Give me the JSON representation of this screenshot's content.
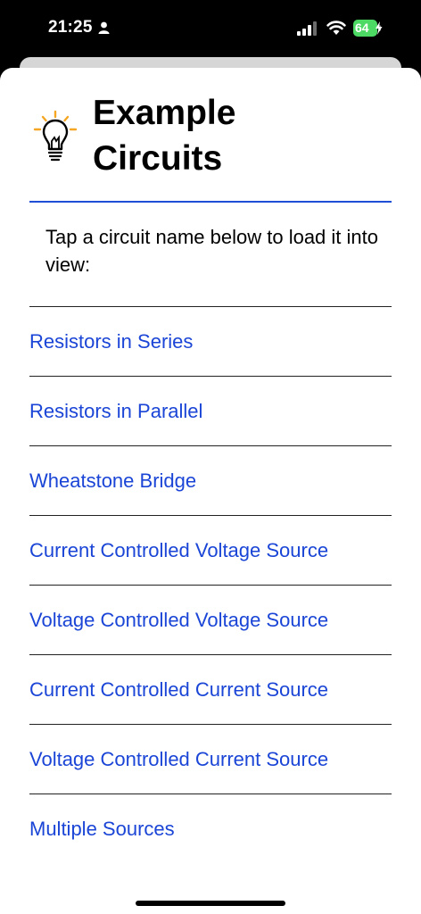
{
  "status_bar": {
    "time": "21:25",
    "battery": "64",
    "icons": [
      "person-icon",
      "signal-icon",
      "wifi-icon",
      "battery-icon",
      "charging-bolt-icon"
    ]
  },
  "header": {
    "icon": "lightbulb-icon",
    "title_line1": "Example",
    "title_line2": "Circuits",
    "accent_color": "#1e4fd6",
    "bulb_ray_color": "#f5a623"
  },
  "intro_text": "Tap a circuit name below to load it into view:",
  "circuits": [
    "Resistors in Series",
    "Resistors in Parallel",
    "Wheatstone Bridge",
    "Current Controlled Voltage Source",
    "Voltage Controlled Voltage Source",
    "Current Controlled Current Source",
    "Voltage Controlled Current Source",
    "Multiple Sources"
  ],
  "link_color": "#1a45d6"
}
